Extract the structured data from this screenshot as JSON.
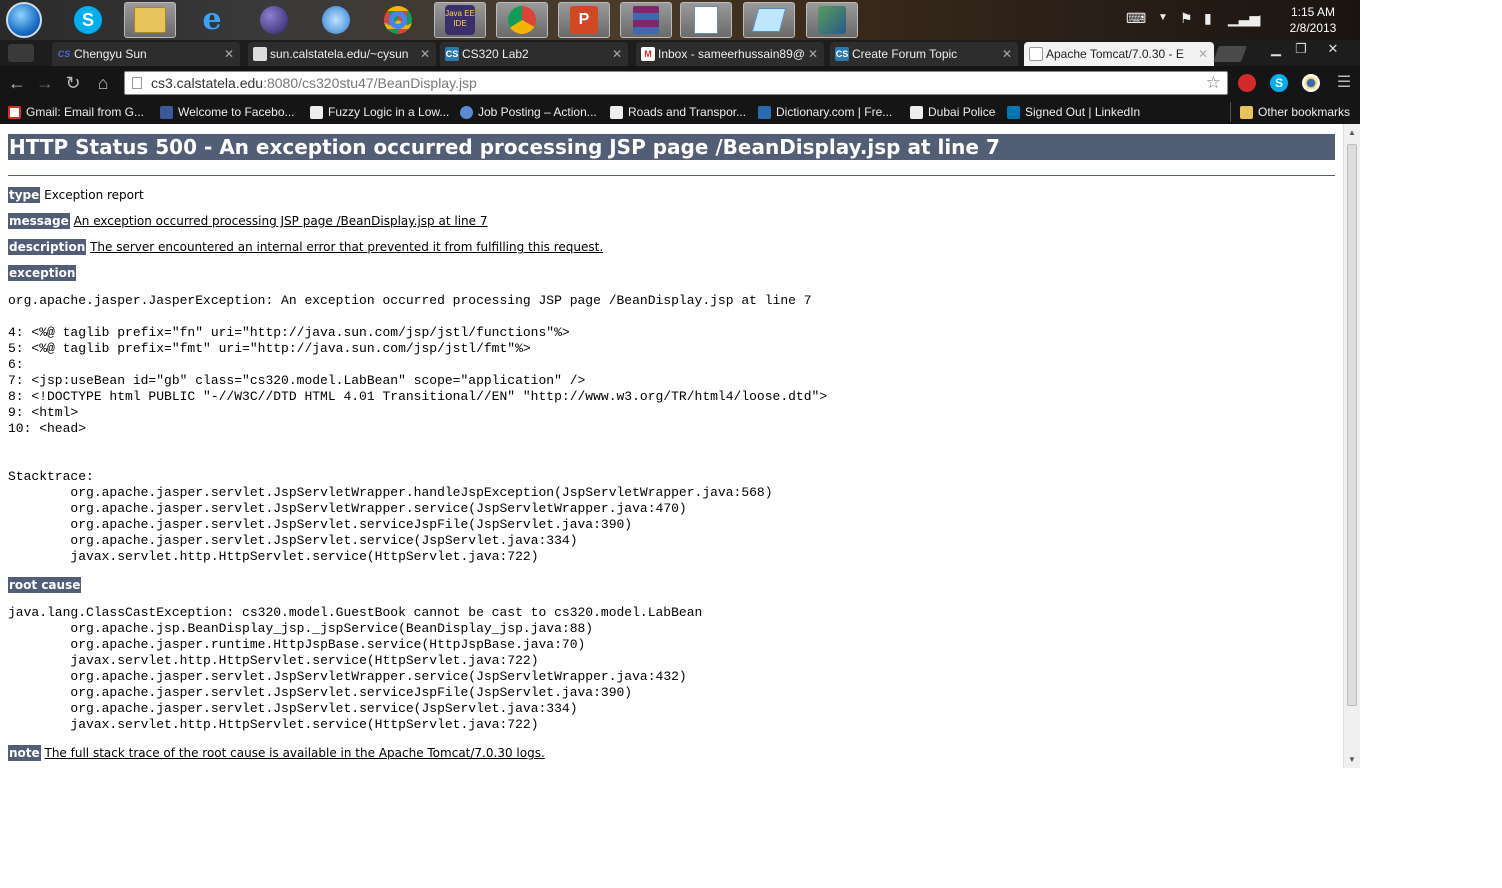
{
  "taskbar": {
    "clock_time": "1:15 AM",
    "clock_date": "2/8/2013",
    "apps": [
      "windows-start",
      "skype",
      "explorer",
      "internet-explorer",
      "eclipse",
      "itunes",
      "chrome",
      "java-ee-ide",
      "chrome-active",
      "powerpoint",
      "winrar",
      "wordpad",
      "paint",
      "network"
    ]
  },
  "browser": {
    "tabs": [
      {
        "label": "Chengyu Sun",
        "icon": "CS"
      },
      {
        "label": "sun.calstatela.edu/~cysun",
        "icon": "doc"
      },
      {
        "label": "CS320 Lab2",
        "icon": "CS"
      },
      {
        "label": "Inbox - sameerhussain89@",
        "icon": "M"
      },
      {
        "label": "Create Forum Topic",
        "icon": "CS"
      },
      {
        "label": "Apache Tomcat/7.0.30 - E",
        "icon": "doc"
      }
    ],
    "url_host": "cs3.calstatela.edu",
    "url_path": ":8080/cs320stu47/BeanDisplay.jsp",
    "bookmarks": [
      "Gmail: Email from G...",
      "Welcome to Facebo...",
      "Fuzzy Logic in a Low...",
      "Job Posting – Action...",
      "Roads and Transpor...",
      "Dictionary.com | Fre...",
      "Dubai Police",
      "Signed Out | LinkedIn",
      "Other bookmarks"
    ]
  },
  "page": {
    "title": "HTTP Status 500 - An exception occurred processing JSP page /BeanDisplay.jsp at line 7",
    "type_label": "type",
    "type_value": "Exception report",
    "message_label": "message",
    "message_value": "An exception occurred processing JSP page /BeanDisplay.jsp at line 7",
    "description_label": "description",
    "description_value": "The server encountered an internal error that prevented it from fulfilling this request.",
    "exception_label": "exception",
    "exception_text": "org.apache.jasper.JasperException: An exception occurred processing JSP page /BeanDisplay.jsp at line 7\n\n4: <%@ taglib prefix=\"fn\" uri=\"http://java.sun.com/jsp/jstl/functions\"%>\n5: <%@ taglib prefix=\"fmt\" uri=\"http://java.sun.com/jsp/jstl/fmt\"%>\n6: \n7: <jsp:useBean id=\"gb\" class=\"cs320.model.LabBean\" scope=\"application\" />\n8: <!DOCTYPE html PUBLIC \"-//W3C//DTD HTML 4.01 Transitional//EN\" \"http://www.w3.org/TR/html4/loose.dtd\">\n9: <html>\n10: <head>\n\n\nStacktrace:\n\torg.apache.jasper.servlet.JspServletWrapper.handleJspException(JspServletWrapper.java:568)\n\torg.apache.jasper.servlet.JspServletWrapper.service(JspServletWrapper.java:470)\n\torg.apache.jasper.servlet.JspServlet.serviceJspFile(JspServlet.java:390)\n\torg.apache.jasper.servlet.JspServlet.service(JspServlet.java:334)\n\tjavax.servlet.http.HttpServlet.service(HttpServlet.java:722)",
    "root_cause_label": "root cause",
    "root_cause_text": "java.lang.ClassCastException: cs320.model.GuestBook cannot be cast to cs320.model.LabBean\n\torg.apache.jsp.BeanDisplay_jsp._jspService(BeanDisplay_jsp.java:88)\n\torg.apache.jasper.runtime.HttpJspBase.service(HttpJspBase.java:70)\n\tjavax.servlet.http.HttpServlet.service(HttpServlet.java:722)\n\torg.apache.jasper.servlet.JspServletWrapper.service(JspServletWrapper.java:432)\n\torg.apache.jasper.servlet.JspServlet.serviceJspFile(JspServlet.java:390)\n\torg.apache.jasper.servlet.JspServlet.service(JspServlet.java:334)\n\tjavax.servlet.http.HttpServlet.service(HttpServlet.java:722)",
    "note_label": "note",
    "note_value": "The full stack trace of the root cause is available in the Apache Tomcat/7.0.30 logs."
  },
  "colors": {
    "tomcat_header": "#525d76"
  }
}
